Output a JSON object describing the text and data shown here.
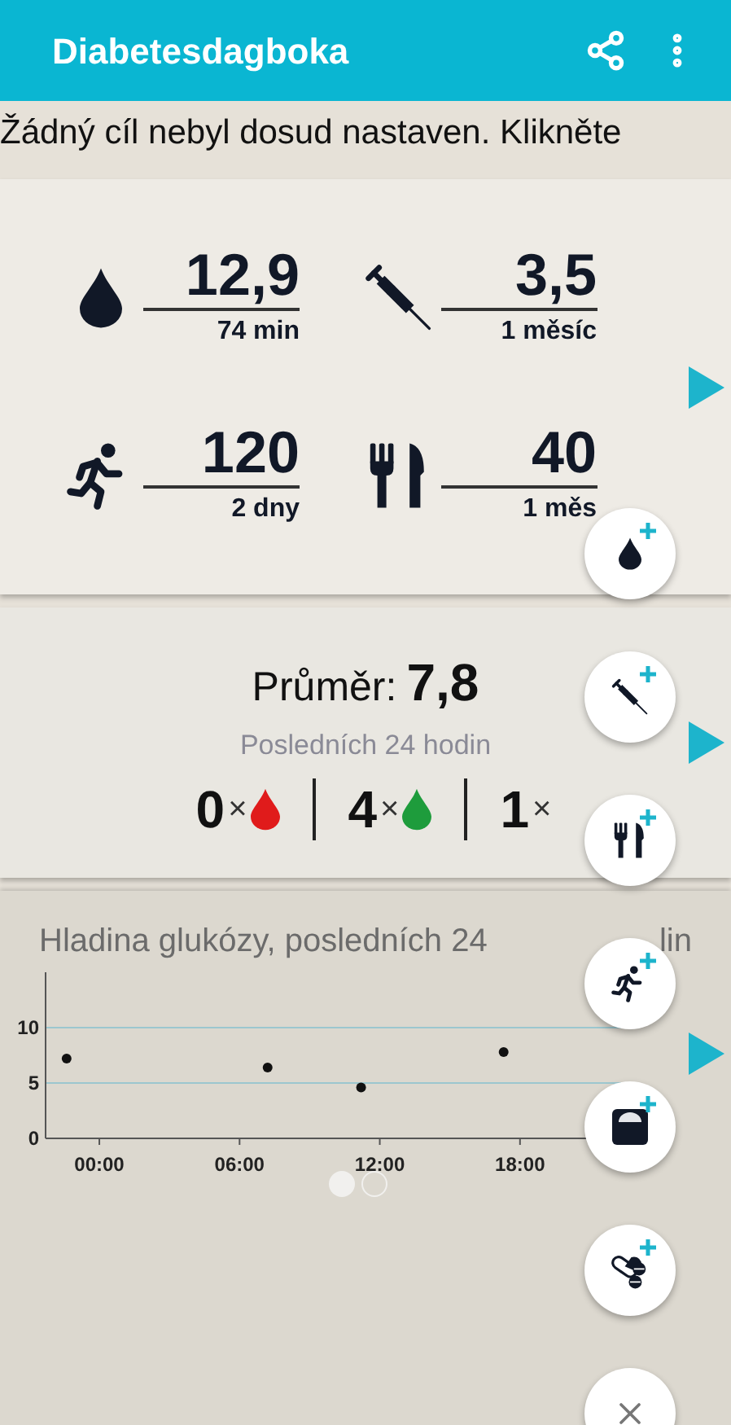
{
  "app_bar": {
    "title": "Diabetesdagboka"
  },
  "goal_banner": "Žádný cíl nebyl dosud nastaven. Klikněte",
  "latest": [
    {
      "kind": "glucose",
      "value": "12,9",
      "ago": "74 min"
    },
    {
      "kind": "insulin",
      "value": "3,5",
      "ago": "1 měsíc"
    },
    {
      "kind": "exercise",
      "value": "120",
      "ago": "2 dny"
    },
    {
      "kind": "food",
      "value": "40",
      "ago": "1 měs"
    }
  ],
  "average": {
    "label": "Průměr:",
    "value": "7,8",
    "period": "Posledních 24 hodin",
    "counts": [
      {
        "count": "0",
        "sign": "×",
        "color": "#e01b1b"
      },
      {
        "count": "4",
        "sign": "×",
        "color": "#1e9c3c"
      },
      {
        "count": "1",
        "sign": "×"
      }
    ]
  },
  "chart_card": {
    "title": "Hladina glukózy, posledních 24",
    "title_tail": "lin",
    "chart_data": {
      "type": "scatter",
      "x": [
        -1.4,
        7.2,
        11.2,
        17.3
      ],
      "series": [
        {
          "color": "#111111",
          "values": [
            7.2,
            6.4,
            4.6,
            7.8
          ]
        }
      ],
      "xlim": [
        -2.3,
        22.5
      ],
      "ylim": [
        0,
        15
      ],
      "xticks": [
        {
          "value": 0,
          "label": "00:00"
        },
        {
          "value": 6,
          "label": "06:00"
        },
        {
          "value": 12,
          "label": "12:00"
        },
        {
          "value": 18,
          "label": "18:00"
        }
      ],
      "yticks": [
        0,
        5,
        10
      ]
    },
    "pager": [
      {
        "selected": true
      },
      {
        "selected": false
      }
    ]
  },
  "fab_menu": [
    {
      "kind": "glucose"
    },
    {
      "kind": "insulin"
    },
    {
      "kind": "food"
    },
    {
      "kind": "exercise"
    },
    {
      "kind": "weight"
    },
    {
      "kind": "medication"
    },
    {
      "kind": "close"
    }
  ]
}
